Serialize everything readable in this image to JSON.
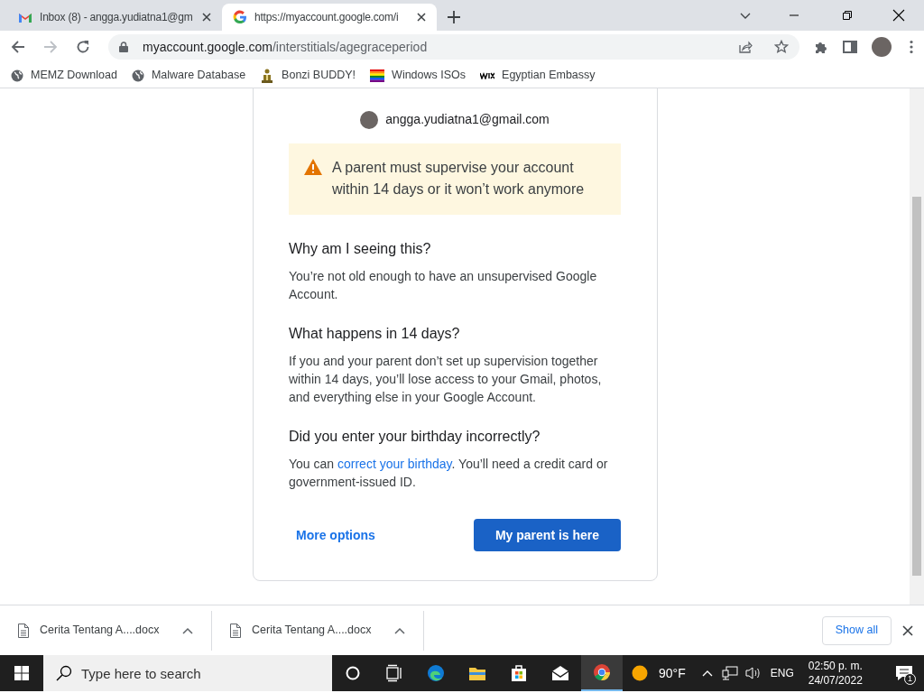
{
  "tabs": [
    {
      "kind": "gmail",
      "title": "Inbox (8) - angga.yudiatna1@gm",
      "selected": false
    },
    {
      "kind": "google",
      "title": "https://myaccount.google.com/i",
      "selected": true
    }
  ],
  "address": {
    "host": "myaccount.google.com",
    "path": "/interstitials/agegraceperiod"
  },
  "bookmarks": [
    {
      "kind": "globe",
      "label": "MEMZ Download"
    },
    {
      "kind": "globe",
      "label": "Malware Database"
    },
    {
      "kind": "buddy",
      "label": "Bonzi BUDDY!"
    },
    {
      "kind": "rainbow",
      "label": "Windows ISOs"
    },
    {
      "kind": "wix",
      "label": "Egyptian Embassy"
    }
  ],
  "card": {
    "email": "angga.yudiatna1@gmail.com",
    "warning": "A parent must supervise your account within 14 days or it won’t work anymore",
    "sections": [
      {
        "heading": "Why am I seeing this?",
        "body": "You’re not old enough to have an unsupervised Google Account."
      },
      {
        "heading": "What happens in 14 days?",
        "body": "If you and your parent don’t set up supervision together within 14 days, you’ll lose access to your Gmail, photos, and everything else in your Google Account."
      },
      {
        "heading": "Did you enter your birthday incorrectly?",
        "body": "You can ",
        "link": "correct your birthday",
        "body_after": ". You’ll need a credit card or government-issued ID."
      }
    ],
    "secondary_button": "More options",
    "primary_button": "My parent is here"
  },
  "downloads": [
    {
      "filename": "Cerita Tentang A....docx"
    },
    {
      "filename": "Cerita Tentang A....docx"
    }
  ],
  "show_all": "Show all",
  "taskbar": {
    "search_placeholder": "Type here to search",
    "apps": [
      {
        "kind": "cortana",
        "selected": false
      },
      {
        "kind": "taskview",
        "selected": false
      },
      {
        "kind": "edge",
        "selected": false
      },
      {
        "kind": "explorer",
        "selected": false
      },
      {
        "kind": "store",
        "selected": false
      },
      {
        "kind": "mail",
        "selected": false
      },
      {
        "kind": "chrome",
        "selected": true
      }
    ],
    "temperature": "90°F",
    "language": "ENG",
    "time": "02:50 p. m.",
    "date": "24/07/2022",
    "notifications": "1"
  }
}
